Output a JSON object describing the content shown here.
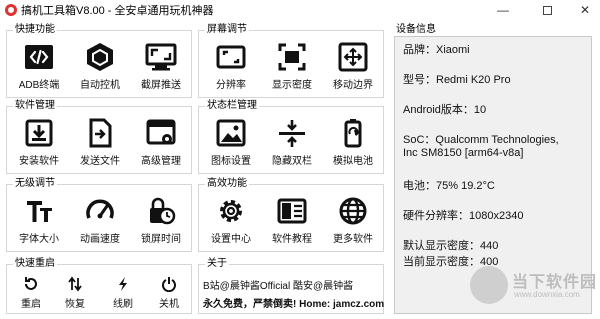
{
  "window": {
    "title": "搞机工具箱V8.00 - 全安卓通用玩机神器",
    "min_glyph": "—",
    "close_glyph": "✕"
  },
  "groups": {
    "quick": {
      "title": "快捷功能",
      "tools": [
        {
          "label": "ADB终端",
          "icon": "code-icon"
        },
        {
          "label": "自动控机",
          "icon": "hexagon-icon"
        },
        {
          "label": "截屏推送",
          "icon": "screen-cast-icon"
        }
      ]
    },
    "screen": {
      "title": "屏幕调节",
      "tools": [
        {
          "label": "分辨率",
          "icon": "resolution-icon"
        },
        {
          "label": "显示密度",
          "icon": "density-icon"
        },
        {
          "label": "移动边界",
          "icon": "move-border-icon"
        }
      ]
    },
    "software": {
      "title": "软件管理",
      "tools": [
        {
          "label": "安装软件",
          "icon": "install-icon"
        },
        {
          "label": "发送文件",
          "icon": "send-file-icon"
        },
        {
          "label": "高级管理",
          "icon": "advanced-manage-icon"
        }
      ]
    },
    "statusbar": {
      "title": "状态栏管理",
      "tools": [
        {
          "label": "图标设置",
          "icon": "image-icon"
        },
        {
          "label": "隐藏双栏",
          "icon": "hide-bar-icon"
        },
        {
          "label": "模拟电池",
          "icon": "battery-icon"
        }
      ]
    },
    "wireless": {
      "title": "无级调节",
      "tools": [
        {
          "label": "字体大小",
          "icon": "font-size-icon"
        },
        {
          "label": "动画速度",
          "icon": "speedometer-icon"
        },
        {
          "label": "锁屏时间",
          "icon": "lock-clock-icon"
        }
      ]
    },
    "advanced": {
      "title": "高效功能",
      "tools": [
        {
          "label": "设置中心",
          "icon": "gear-icon"
        },
        {
          "label": "软件教程",
          "icon": "tutorial-icon"
        },
        {
          "label": "更多软件",
          "icon": "globe-icon"
        }
      ]
    },
    "reboot": {
      "title": "快速重启",
      "tools": [
        {
          "label": "重启",
          "icon": "restart-icon"
        },
        {
          "label": "恢复",
          "icon": "recovery-icon"
        },
        {
          "label": "线刷",
          "icon": "flash-icon"
        },
        {
          "label": "关机",
          "icon": "power-icon"
        }
      ]
    },
    "about": {
      "title": "关于",
      "line1": "B站@晨钟酱Official   酷安@晨钟酱",
      "line2": "永久免费，严禁倒卖! Home: jamcz.com"
    }
  },
  "device_info": {
    "title": "设备信息",
    "lines": [
      "品牌：Xiaomi",
      "型号：Redmi K20 Pro",
      "Android版本：10",
      "SoC：Qualcomm Technologies,",
      "Inc SM8150 [arm64-v8a]",
      "电池：75%  19.2°C",
      "硬件分辨率：1080x2340",
      "默认显示密度：440",
      "当前显示密度：400"
    ]
  },
  "watermark": {
    "text": "当下软件园",
    "url": "www.downxia.com"
  }
}
